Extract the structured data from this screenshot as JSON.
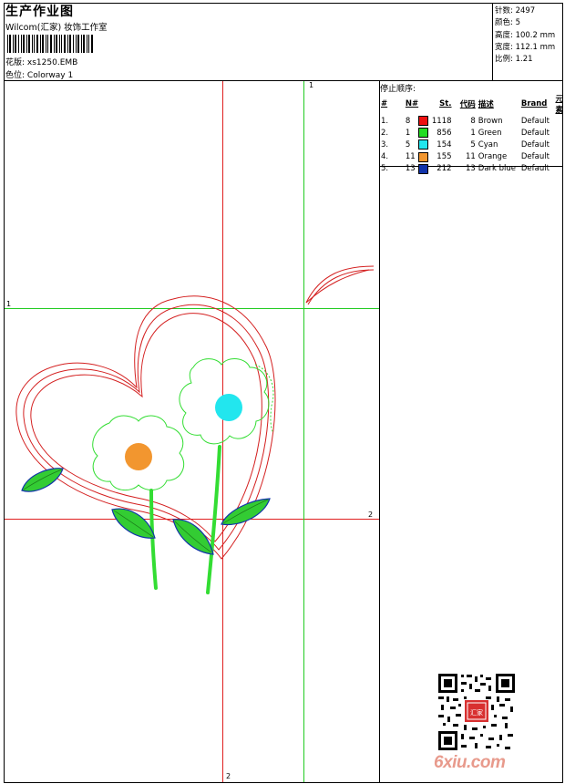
{
  "header": {
    "title": "生产作业图",
    "company": "Wilcom(汇家) 妆饰工作室",
    "design_label": "花版:",
    "design_file": "xs1250.EMB",
    "colorway_label": "色位:",
    "colorway_name": "Colorway 1"
  },
  "stats": [
    {
      "label": "针数:",
      "value": "2497"
    },
    {
      "label": "颜色:",
      "value": "5"
    },
    {
      "label": "高度:",
      "value": "100.2 mm"
    },
    {
      "label": "宽度:",
      "value": "112.1 mm"
    },
    {
      "label": "比例:",
      "value": "1.21"
    }
  ],
  "stop_sequence": {
    "title": "停止顺序:",
    "headers": {
      "index": "#",
      "needle": "N#",
      "stitches": "St.",
      "code": "代码",
      "description": "描述",
      "brand": "Brand",
      "element": "元素"
    },
    "rows": [
      {
        "index": "1.",
        "needle": "8",
        "color": "#ee1111",
        "stitches": "1118",
        "code": "8",
        "description": "Brown",
        "brand": "Default"
      },
      {
        "index": "2.",
        "needle": "1",
        "color": "#22dd22",
        "stitches": "856",
        "code": "1",
        "description": "Green",
        "brand": "Default"
      },
      {
        "index": "3.",
        "needle": "5",
        "color": "#22e6ee",
        "stitches": "154",
        "code": "5",
        "description": "Cyan",
        "brand": "Default"
      },
      {
        "index": "4.",
        "needle": "11",
        "color": "#f2962f",
        "stitches": "155",
        "code": "11",
        "description": "Orange",
        "brand": "Default"
      },
      {
        "index": "5.",
        "needle": "13",
        "color": "#1133aa",
        "stitches": "212",
        "code": "13",
        "description": "Dark blue",
        "brand": "Default"
      }
    ]
  },
  "guides": {
    "green_label_top": "1",
    "green_label_left": "1",
    "red_label_right": "2",
    "red_label_bottom": "2"
  },
  "watermark": "6xiu.com",
  "qr_seal_text": "汇家"
}
